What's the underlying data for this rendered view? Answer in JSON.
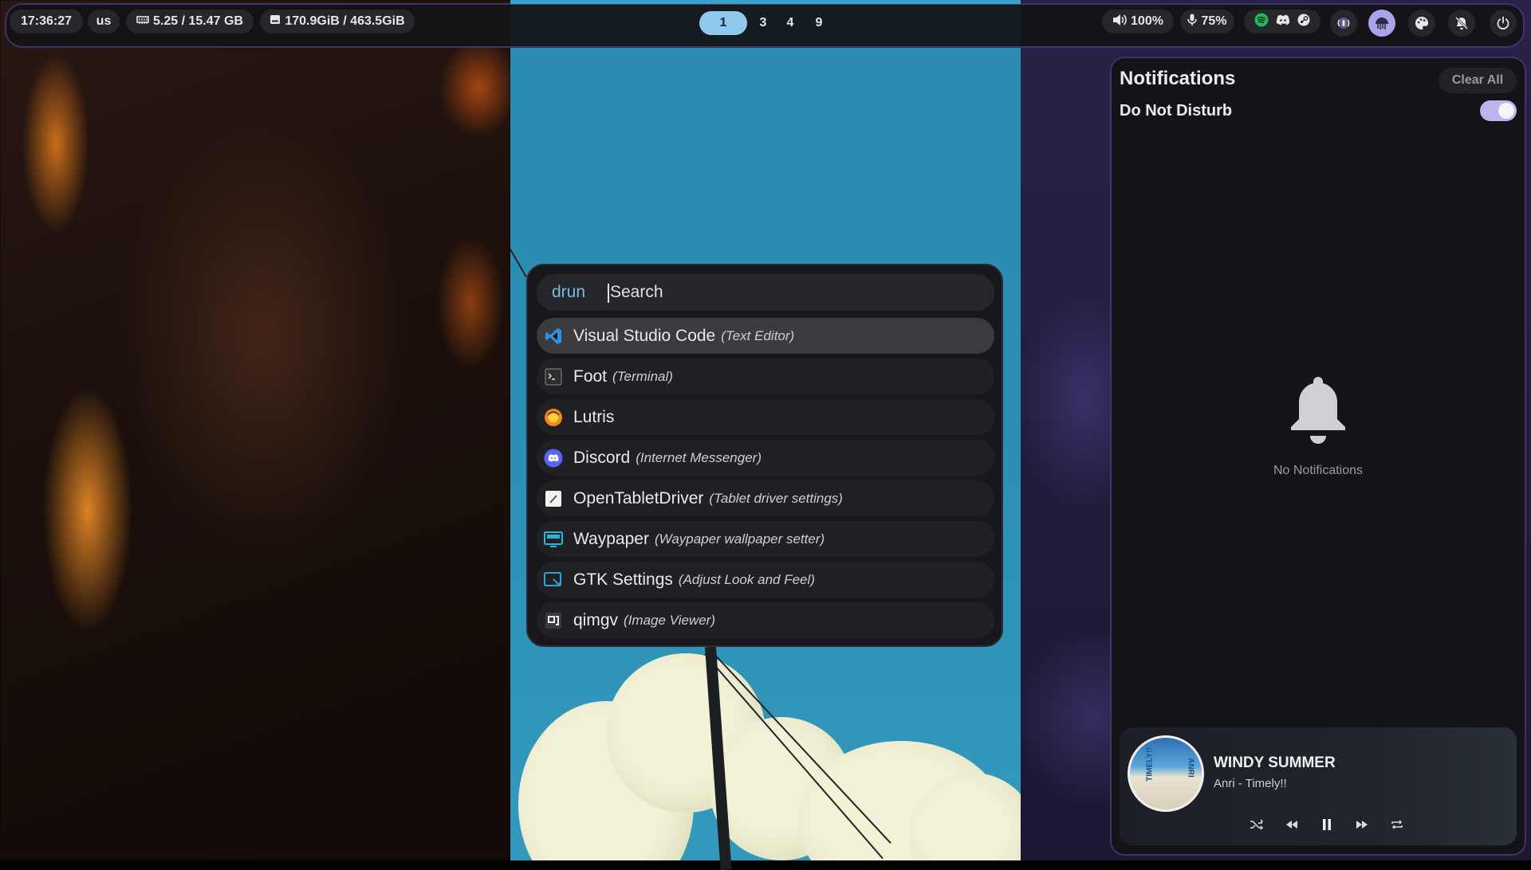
{
  "topbar": {
    "clock": "17:36:27",
    "keyboard_layout": "us",
    "memory": "5.25 / 15.47 GB",
    "disk": "170.9GiB / 463.5GiB",
    "workspaces": [
      "1",
      "3",
      "4",
      "9"
    ],
    "active_workspace": "1",
    "volume": "100%",
    "mic": "75%",
    "tray_icons": [
      "spotify-icon",
      "discord-icon",
      "steam-icon"
    ],
    "right_icons": [
      "broadcast-icon",
      "jellyfish-icon",
      "palette-icon",
      "bell-off-icon",
      "power-icon"
    ]
  },
  "launcher": {
    "mode": "drun",
    "search_placeholder": "Search",
    "search_value": "",
    "apps": [
      {
        "name": "Visual Studio Code",
        "desc": "(Text Editor)",
        "icon": "vscode-icon",
        "selected": true
      },
      {
        "name": "Foot",
        "desc": "(Terminal)",
        "icon": "terminal-icon",
        "selected": false
      },
      {
        "name": "Lutris",
        "desc": "",
        "icon": "lutris-icon",
        "selected": false
      },
      {
        "name": "Discord",
        "desc": "(Internet Messenger)",
        "icon": "discord-icon",
        "selected": false
      },
      {
        "name": "OpenTabletDriver",
        "desc": "(Tablet driver settings)",
        "icon": "tablet-icon",
        "selected": false
      },
      {
        "name": "Waypaper",
        "desc": "(Waypaper wallpaper setter)",
        "icon": "wallpaper-icon",
        "selected": false
      },
      {
        "name": "GTK Settings",
        "desc": "(Adjust Look and Feel)",
        "icon": "settings-window-icon",
        "selected": false
      },
      {
        "name": "qimgv",
        "desc": "(Image Viewer)",
        "icon": "image-viewer-icon",
        "selected": false
      }
    ]
  },
  "notifications": {
    "title": "Notifications",
    "clear_label": "Clear All",
    "dnd_label": "Do Not Disturb",
    "dnd_enabled": true,
    "empty_text": "No Notifications"
  },
  "media": {
    "title": "WINDY SUMMER",
    "artist": "Anri - Timely!!",
    "album_art_text": [
      "TIMELY!!",
      "ANRI"
    ],
    "controls": [
      "shuffle-icon",
      "previous-icon",
      "pause-icon",
      "next-icon",
      "repeat-icon"
    ]
  },
  "colors": {
    "accent_border": "#3e3566",
    "workspace_active": "#8fc9ee",
    "launcher_mode": "#7ab9e0",
    "toggle_on": "#b9b6ee"
  }
}
